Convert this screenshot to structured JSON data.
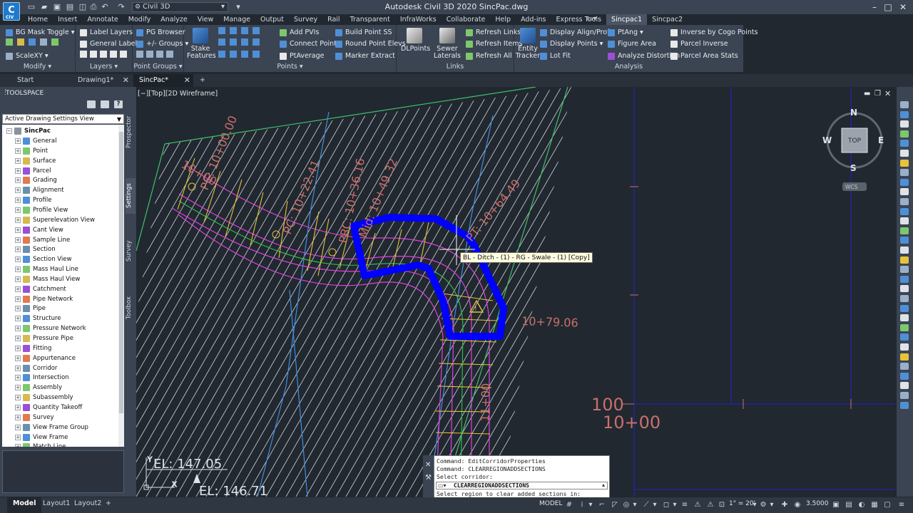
{
  "app": {
    "logo_text": "C",
    "logo_sub": "CIV",
    "workspace": "Civil 3D",
    "title": "Autodesk Civil 3D 2020    SincPac.dwg"
  },
  "menu_tabs": [
    "Home",
    "Insert",
    "Annotate",
    "Modify",
    "Analyze",
    "View",
    "Manage",
    "Output",
    "Survey",
    "Rail",
    "Transparent",
    "InfraWorks",
    "Collaborate",
    "Help",
    "Add-ins",
    "Express Tools",
    "Sincpac1",
    "Sincpac2"
  ],
  "ribbon": {
    "modify": {
      "title": "Modify",
      "items": [
        "BG Mask Toggle",
        "ScaleXY"
      ]
    },
    "layers": {
      "title": "Layers",
      "items": [
        "Label Layers",
        "General Labels"
      ]
    },
    "point_groups": {
      "title": "Point Groups",
      "items": [
        "PG Browser",
        "+/- Groups"
      ]
    },
    "points": {
      "title": "Points",
      "stake_features": "Stake Features",
      "items": [
        "Add PVIs",
        "Connect Points",
        "PtAverage",
        "Build Point SS",
        "Round Point Elevs",
        "Marker Extract"
      ]
    },
    "links": {
      "title": "Links",
      "dlpoints": "DLPoints",
      "sewer_laterals": "Sewer Laterals",
      "items": [
        "Refresh Links",
        "Refresh Items",
        "Refresh All"
      ]
    },
    "analysis": {
      "title": "Analysis",
      "entity_tracker": "Entity Tracker",
      "items": [
        "Display Align/Prof",
        "Display Points",
        "Lot Fit",
        "PtAng",
        "Figure Area",
        "Analyze Distortion",
        "Inverse by Cogo Points",
        "Parcel Inverse",
        "Parcel Area Stats"
      ]
    }
  },
  "doc_tabs": [
    "Start",
    "Drawing1*",
    "SincPac*"
  ],
  "toolspace": {
    "title": "TOOLSPACE",
    "view_select": "Active Drawing Settings View",
    "root": "SincPac",
    "items": [
      "General",
      "Point",
      "Surface",
      "Parcel",
      "Grading",
      "Alignment",
      "Profile",
      "Profile View",
      "Superelevation View",
      "Cant View",
      "Sample Line",
      "Section",
      "Section View",
      "Mass Haul Line",
      "Mass Haul View",
      "Catchment",
      "Pipe Network",
      "Pipe",
      "Structure",
      "Pressure Network",
      "Pressure Pipe",
      "Fitting",
      "Appurtenance",
      "Corridor",
      "Intersection",
      "Assembly",
      "Subassembly",
      "Quantity Takeoff",
      "Survey",
      "View Frame Group",
      "View Frame",
      "Match Line"
    ],
    "side_tabs": [
      "Prospector",
      "Settings",
      "Survey",
      "Toolbox"
    ]
  },
  "viewport": {
    "label": "[−][Top][2D Wireframe]",
    "tooltip": "BL - Ditch - (1) - RG - Swale - (1) [Copy]",
    "stations": [
      "PC: 10+00.00",
      "10+00",
      "PC: 10+22.41",
      "PRC: 10+36.16",
      "Mid: 10+49.32",
      "PT: 10+64.49",
      "10+79.06",
      "11+00"
    ],
    "profile_text": [
      "100",
      "10+00"
    ],
    "elevations": [
      "EL: 147.05",
      "EL: 146.71"
    ],
    "viewcube": {
      "top": "TOP",
      "n": "N",
      "s": "S",
      "e": "E",
      "w": "W",
      "wcs": "WCS"
    }
  },
  "command": {
    "history": [
      "Command: EditCorridorProperties",
      "Command: CLEARREGIONADDSECTIONS",
      "Select corridor:"
    ],
    "current": "CLEARREGIONADDSECTIONS",
    "prompt": "Select region to clear added sections in:"
  },
  "status": {
    "layout_tabs": [
      "Model",
      "Layout1",
      "Layout2"
    ],
    "model_label": "MODEL",
    "scale": "1\" = 20'",
    "value": "3.5000"
  },
  "colors": {
    "accent": "#1f7acb",
    "selection": "#0000ff",
    "station_text": "#c9706a"
  }
}
